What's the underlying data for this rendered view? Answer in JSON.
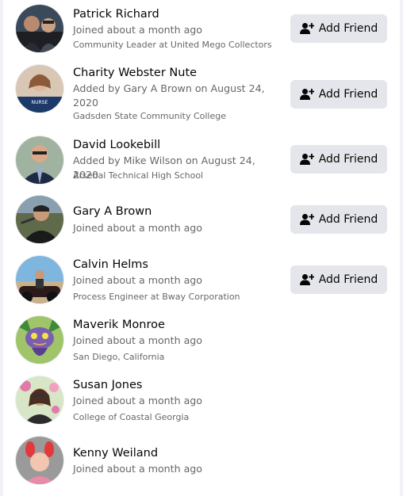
{
  "members": [
    {
      "name": "Patrick Richard",
      "joined": "Joined about a month ago",
      "detail": "Community Leader at United Mego Collectors",
      "action": "Add Friend",
      "avatar": "patrick-richard-photo"
    },
    {
      "name": "Charity Webster Nute",
      "joined": "Added by Gary A Brown on August 24, 2020",
      "detail": "Gadsden State Community College",
      "action": "Add Friend",
      "avatar": "charity-webster-nute-photo",
      "badge_text": "NURSE"
    },
    {
      "name": "David Lookebill",
      "joined": "Added by Mike Wilson on August 24, 2020",
      "detail": "Arsenal Technical High School",
      "action": "Add Friend",
      "avatar": "david-lookebill-photo"
    },
    {
      "name": "Gary A Brown",
      "joined": "Joined about a month ago",
      "detail": "",
      "action": "Add Friend",
      "avatar": "gary-a-brown-photo"
    },
    {
      "name": "Calvin Helms",
      "joined": "Joined about a month ago",
      "detail": "Process Engineer at Bway Corporation",
      "action": "Add Friend",
      "avatar": "calvin-helms-photo"
    },
    {
      "name": "Maverik Monroe",
      "joined": "Joined about a month ago",
      "detail": "San Diego, California",
      "action": "",
      "avatar": "maverik-monroe-photo"
    },
    {
      "name": "Susan Jones",
      "joined": "Joined about a month ago",
      "detail": "College of Coastal Georgia",
      "action": "",
      "avatar": "susan-jones-photo"
    },
    {
      "name": "Kenny Weiland",
      "joined": "Joined about a month ago",
      "detail": "",
      "action": "",
      "avatar": "kenny-weiland-photo"
    }
  ],
  "icons": {
    "add_friend": "person-plus-icon"
  },
  "colors": {
    "button_bg": "#e4e6eb",
    "secondary_text": "#65676b",
    "primary_text": "#050505"
  }
}
